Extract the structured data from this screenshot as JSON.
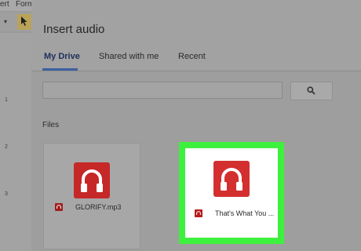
{
  "background": {
    "menu_items": [
      "ert",
      "Form"
    ],
    "ruler_numbers": [
      "1",
      "2",
      "3"
    ],
    "dropdown_icon": "chevron-down-icon",
    "cursor_icon": "cursor-arrow-icon"
  },
  "dialog": {
    "title": "Insert audio",
    "tabs": [
      {
        "label": "My Drive"
      },
      {
        "label": "Shared with me"
      },
      {
        "label": "Recent"
      }
    ],
    "search": {
      "value": "",
      "button_icon": "search-icon"
    },
    "section_label": "Files",
    "files": [
      {
        "name": "GLORIFY.mp3",
        "icon": "audio-file-icon"
      },
      {
        "name": "That's What You ...",
        "icon": "audio-file-icon",
        "selected": true
      }
    ]
  },
  "colors": {
    "audio_red": "#d32f2f",
    "selection_green": "#3ef03e",
    "active_tab": "#1c2f5a"
  }
}
